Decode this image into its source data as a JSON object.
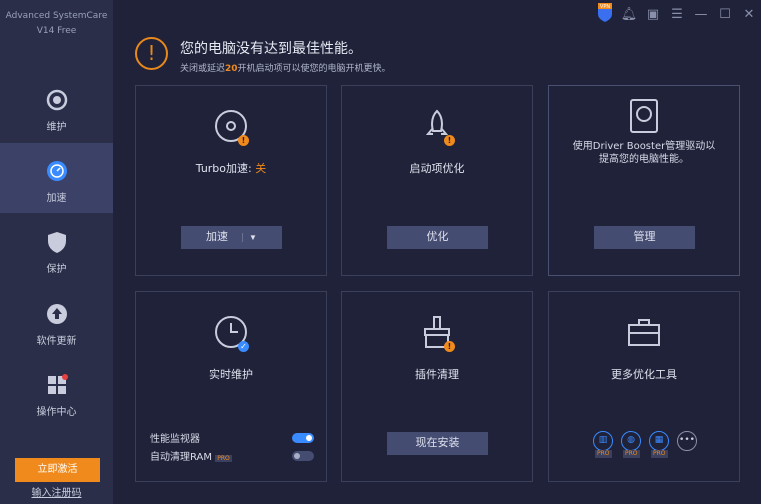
{
  "app": {
    "name": "Advanced SystemCare",
    "version": "V14 Free"
  },
  "topbar": {
    "vpn": "VPN",
    "icons": [
      "vpn-shield-icon",
      "bell-icon",
      "toolbox-icon",
      "menu-icon",
      "minimize-icon",
      "maximize-icon",
      "close-icon"
    ]
  },
  "sidebar": {
    "items": [
      {
        "label": "维护"
      },
      {
        "label": "加速"
      },
      {
        "label": "保护"
      },
      {
        "label": "软件更新"
      },
      {
        "label": "操作中心"
      }
    ],
    "activate": "立即激活",
    "register": "输入注册码"
  },
  "alert": {
    "title": "您的电脑没有达到最佳性能。",
    "pre": "关闭或延迟",
    "count": "20",
    "post": "开机启动项可以使您的电脑开机更快。"
  },
  "cards": {
    "turbo": {
      "title": "Turbo加速: ",
      "state": "关",
      "button": "加速"
    },
    "startup": {
      "title": "启动项优化",
      "button": "优化"
    },
    "driver": {
      "text": "使用Driver Booster管理驱动以提高您的电脑性能。",
      "button": "管理"
    },
    "realtime": {
      "title": "实时维护",
      "monitor": "性能监视器",
      "ram": "自动清理RAM",
      "pro": "PRO",
      "monitor_on": true,
      "ram_on": false
    },
    "plugin": {
      "title": "插件清理",
      "button": "现在安装"
    },
    "tools": {
      "title": "更多优化工具",
      "pro": "PRO"
    }
  },
  "colors": {
    "accent": "#f08a1c",
    "blue": "#3a8bff"
  }
}
